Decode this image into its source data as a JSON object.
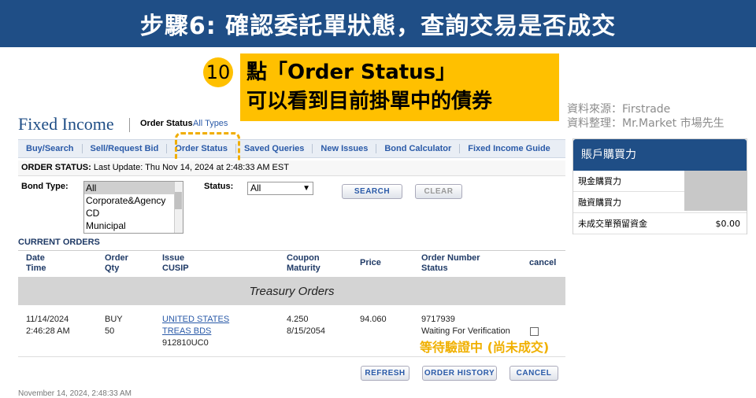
{
  "banner": {
    "title": "步驟6: 確認委託單狀態，查詢交易是否成交"
  },
  "callout": {
    "number": "10",
    "line1": "點「Order Status」",
    "line2": "可以看到目前掛單中的債券"
  },
  "source": {
    "line1": "資料來源：Firstrade",
    "line2": "資料整理：Mr.Market 市場先生"
  },
  "header": {
    "title": "Fixed Income",
    "order_status_label": "Order Status",
    "all_types": "All Types"
  },
  "nav": {
    "items": [
      "Buy/Search",
      "Sell/Request Bid",
      "Order Status",
      "Saved Queries",
      "New Issues",
      "Bond Calculator",
      "Fixed Income Guide"
    ]
  },
  "status_bar": {
    "label": "ORDER STATUS:",
    "text": "Last Update: Thu Nov 14, 2024 at 2:48:33 AM EST"
  },
  "filters": {
    "bond_type_label": "Bond Type:",
    "bond_types": [
      "All",
      "Corporate&Agency",
      "CD",
      "Municipal"
    ],
    "status_label": "Status:",
    "status_value": "All",
    "search_button": "SEARCH",
    "clear_button": "CLEAR"
  },
  "orders": {
    "section_title": "CURRENT ORDERS",
    "headers": {
      "date": "Date",
      "time": "Time",
      "order": "Order",
      "qty": "Qty",
      "issue": "Issue",
      "cusip": "CUSIP",
      "coupon": "Coupon",
      "maturity": "Maturity",
      "price": "Price",
      "order_number": "Order Number",
      "status": "Status",
      "cancel": "cancel"
    },
    "group_label": "Treasury Orders",
    "row": {
      "date": "11/14/2024",
      "time": "2:46:28 AM",
      "order": "BUY",
      "qty": "50",
      "issue_line1": "UNITED STATES",
      "issue_line2": "TREAS BDS",
      "cusip": "912810UC0",
      "coupon": "4.250",
      "maturity": "8/15/2054",
      "price": "94.060",
      "order_number": "9717939",
      "status": "Waiting For Verification"
    },
    "waiting_note": "等待驗證中 (尚未成交)",
    "refresh_button": "REFRESH",
    "history_button": "ORDER HISTORY",
    "cancel_button": "CANCEL",
    "footer_date": "November 14, 2024, 2:48:33 AM"
  },
  "panel": {
    "title": "賬戶購買力",
    "rows": [
      {
        "label": "現金購買力",
        "value": ""
      },
      {
        "label": "融資購買力",
        "value": ""
      },
      {
        "label": "未成交單預留資金",
        "value": "$0.00"
      }
    ]
  },
  "colors": {
    "banner": "#1f4e86",
    "callout": "#ffc000",
    "link": "#2a5aa8",
    "note": "#f0b000"
  }
}
